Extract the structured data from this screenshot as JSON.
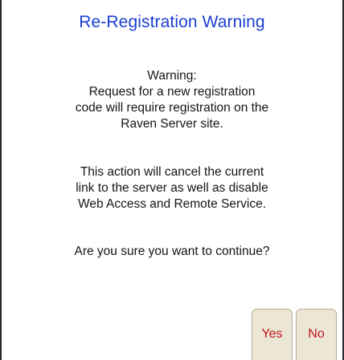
{
  "dialog": {
    "title": "Re-Registration Warning",
    "message_lines": [
      "Warning:",
      "Request for a new registration",
      "code will require registration on the",
      "Raven Server site.",
      "This action will cancel the current",
      "link to the server as well as disable",
      "Web Access and Remote Service.",
      "Are you sure you want to continue?"
    ],
    "buttons": {
      "yes": "Yes",
      "no": "No"
    }
  },
  "colors": {
    "title": "#1a3fd0",
    "text": "#151515",
    "button_bg": "#ece6d4",
    "button_text": "#c0141c",
    "frame": "#2a2a2a"
  }
}
